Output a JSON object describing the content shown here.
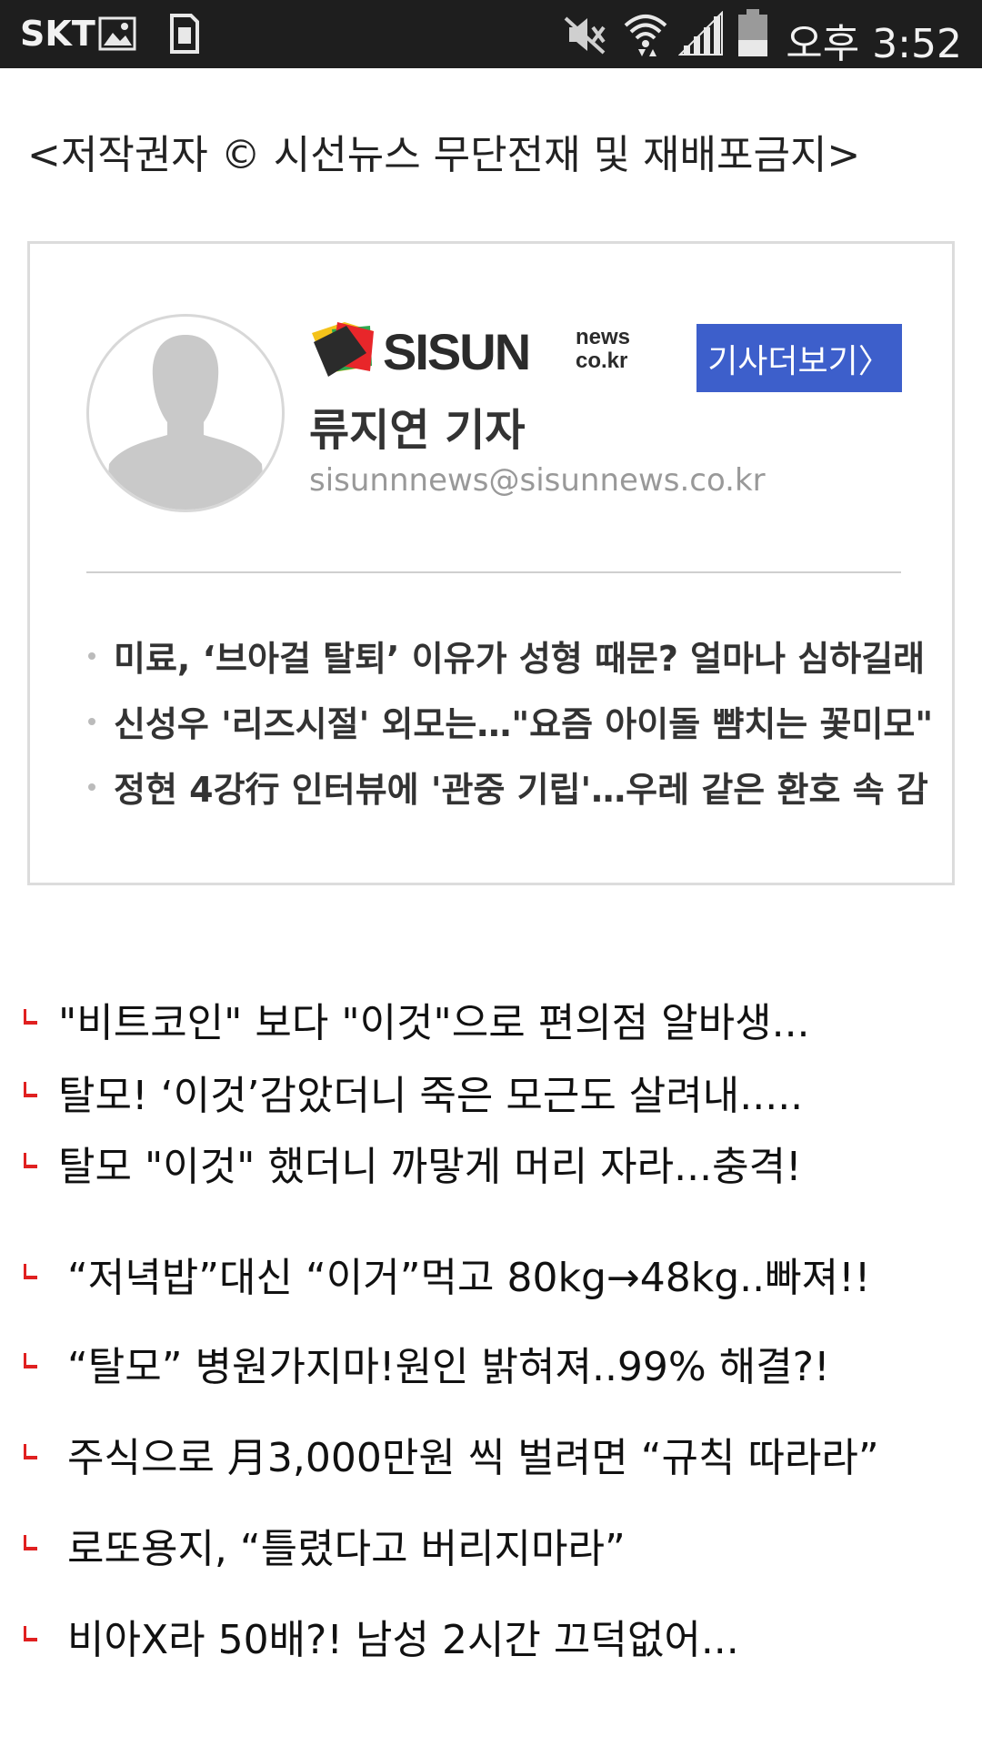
{
  "status_bar": {
    "carrier": "SKT",
    "time": "오후 3:52",
    "icons": [
      "image-notification-icon",
      "sim-card-icon",
      "mute-icon",
      "wifi-icon",
      "signal-icon",
      "battery-icon"
    ]
  },
  "copyright": "<저작권자 © 시선뉴스 무단전재 및 재배포금지>",
  "reporter_card": {
    "logo_text": "SISUN",
    "logo_sub_top": "news",
    "logo_sub_bottom": "co.kr",
    "more_button": "기사더보기〉",
    "name": "류지연 기자",
    "email": "sisunnnews@sisunnews.co.kr",
    "articles": [
      "미료, ‘브아걸 탈퇴’ 이유가 성형 때문? 얼마나 심하길래",
      "신성우 '리즈시절' 외모는…\"요즘 아이돌 뺨치는 꽃미모\"",
      "정현 4강行 인터뷰에 '관중 기립'…우레 같은 환호 속 감"
    ]
  },
  "ad_links": [
    "\"비트코인\" 보다 \"이것\"으로 편의점 알바생...",
    "탈모! ‘이것’감았더니 죽은 모근도 살려내.....",
    "탈모 \"이것\" 했더니 까맣게 머리 자라...충격!",
    "“저녁밥”대신 “이거”먹고 80kg→48kg..빠져!!",
    "“탈모” 병원가지마!원인 밝혀져..99% 해결?!",
    "주식으로 月3,000만원 씩 벌려면 “규칙 따라라”",
    "로또용지, “틀렸다고 버리지마라”",
    "비아X라 50배?! 남성 2시간 끄덕없어..."
  ],
  "colors": {
    "status_bar_bg": "#1e1e1e",
    "button_bg": "#3d5fcb",
    "ad_marker": "#e02020",
    "logo_red": "#e8262a",
    "logo_yellow": "#f4c21a",
    "logo_green": "#2fa84f",
    "logo_dark": "#2b2b2b"
  }
}
